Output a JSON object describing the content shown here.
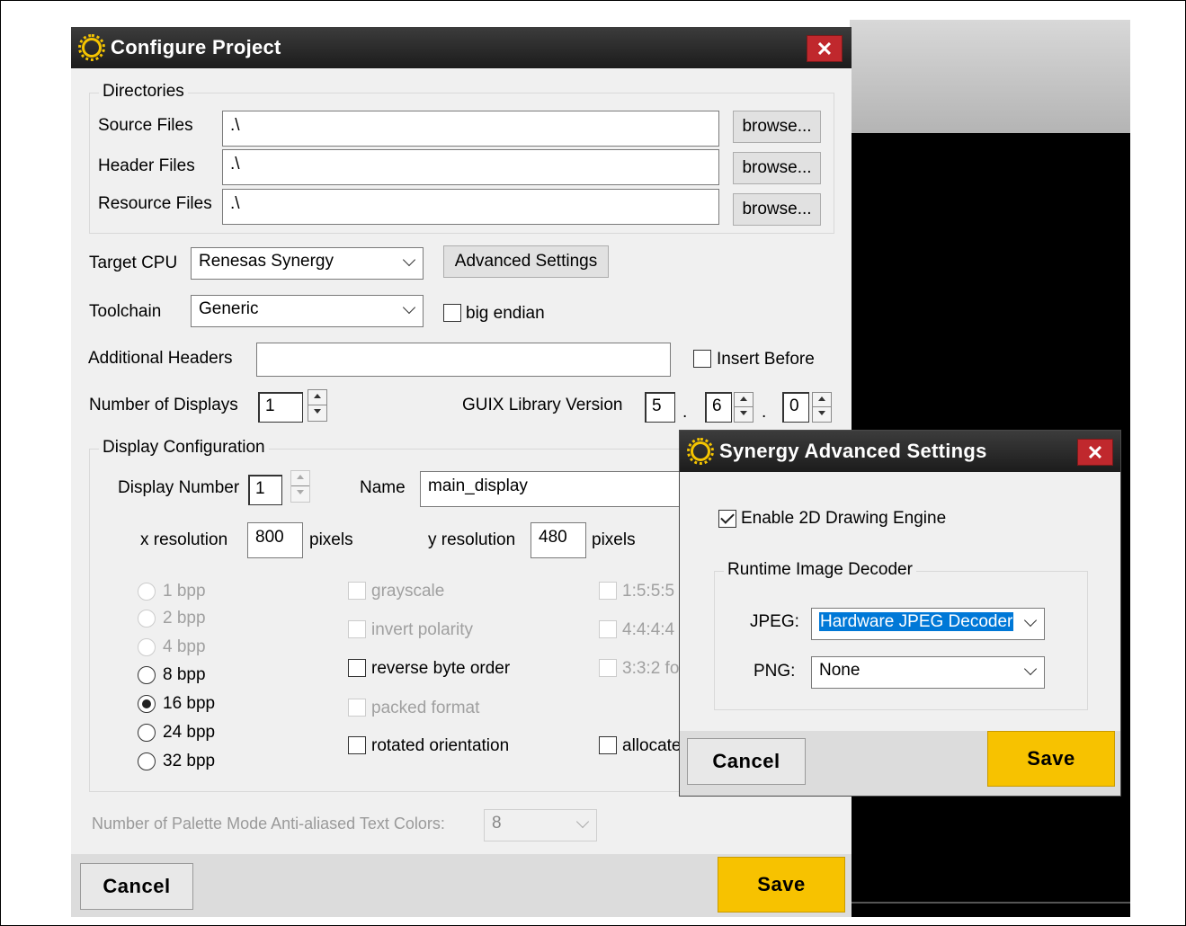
{
  "configure_project": {
    "title": "Configure Project",
    "close_glyph": "✕",
    "directories": {
      "legend": "Directories",
      "rows": [
        {
          "label": "Source Files",
          "value": ".\\",
          "browse": "browse..."
        },
        {
          "label": "Header Files",
          "value": ".\\",
          "browse": "browse..."
        },
        {
          "label": "Resource Files",
          "value": ".\\",
          "browse": "browse..."
        }
      ]
    },
    "target_cpu": {
      "label": "Target CPU",
      "value": "Renesas Synergy"
    },
    "advanced_settings": "Advanced Settings",
    "toolchain": {
      "label": "Toolchain",
      "value": "Generic"
    },
    "big_endian": {
      "label": "big endian",
      "checked": false
    },
    "additional_headers": {
      "label": "Additional Headers",
      "value": ""
    },
    "insert_before": {
      "label": "Insert Before",
      "checked": false
    },
    "number_of_displays": {
      "label": "Number of Displays",
      "value": "1"
    },
    "guix_version": {
      "label": "GUIX Library Version",
      "major": "5",
      "minor": "6",
      "patch": "0",
      "sep": "."
    },
    "display_configuration": {
      "legend": "Display Configuration",
      "display_number": {
        "label": "Display Number",
        "value": "1"
      },
      "name": {
        "label": "Name",
        "value": "main_display"
      },
      "x_resolution": {
        "label": "x resolution",
        "value": "800",
        "unit": "pixels"
      },
      "y_resolution": {
        "label": "y resolution",
        "value": "480",
        "unit": "pixels"
      },
      "bpp": [
        {
          "label": "1 bpp",
          "enabled": false,
          "selected": false
        },
        {
          "label": "2 bpp",
          "enabled": false,
          "selected": false
        },
        {
          "label": "4 bpp",
          "enabled": false,
          "selected": false
        },
        {
          "label": "8 bpp",
          "enabled": true,
          "selected": false
        },
        {
          "label": "16 bpp",
          "enabled": true,
          "selected": true
        },
        {
          "label": "24 bpp",
          "enabled": true,
          "selected": false
        },
        {
          "label": "32 bpp",
          "enabled": true,
          "selected": false
        }
      ],
      "options": [
        {
          "label": "grayscale",
          "enabled": false
        },
        {
          "label": "invert polarity",
          "enabled": false
        },
        {
          "label": "reverse byte order",
          "enabled": true
        },
        {
          "label": "packed format",
          "enabled": false
        },
        {
          "label": "rotated orientation",
          "enabled": true
        }
      ],
      "formats": [
        {
          "label": "1:5:5:5",
          "enabled": false
        },
        {
          "label": "4:4:4:4",
          "enabled": false
        },
        {
          "label": "3:3:2 fo",
          "enabled": false
        },
        {
          "label": "allocate",
          "enabled": true
        }
      ]
    },
    "palette": {
      "label": "Number of Palette Mode Anti-aliased Text Colors:",
      "value": "8"
    },
    "cancel": "Cancel",
    "save": "Save"
  },
  "synergy_advanced": {
    "title": "Synergy Advanced Settings",
    "close_glyph": "✕",
    "enable_2d": {
      "label": "Enable 2D Drawing Engine",
      "checked": true
    },
    "decoder_group": "Runtime Image Decoder",
    "jpeg": {
      "label": "JPEG:",
      "value": "Hardware JPEG Decoder"
    },
    "png": {
      "label": "PNG:",
      "value": "None"
    },
    "cancel": "Cancel",
    "save": "Save"
  },
  "colors": {
    "accent_yellow": "#f7c200",
    "close_red": "#c0282d",
    "titlebar": "#2a2a2a",
    "selection_blue": "#0078d7"
  }
}
